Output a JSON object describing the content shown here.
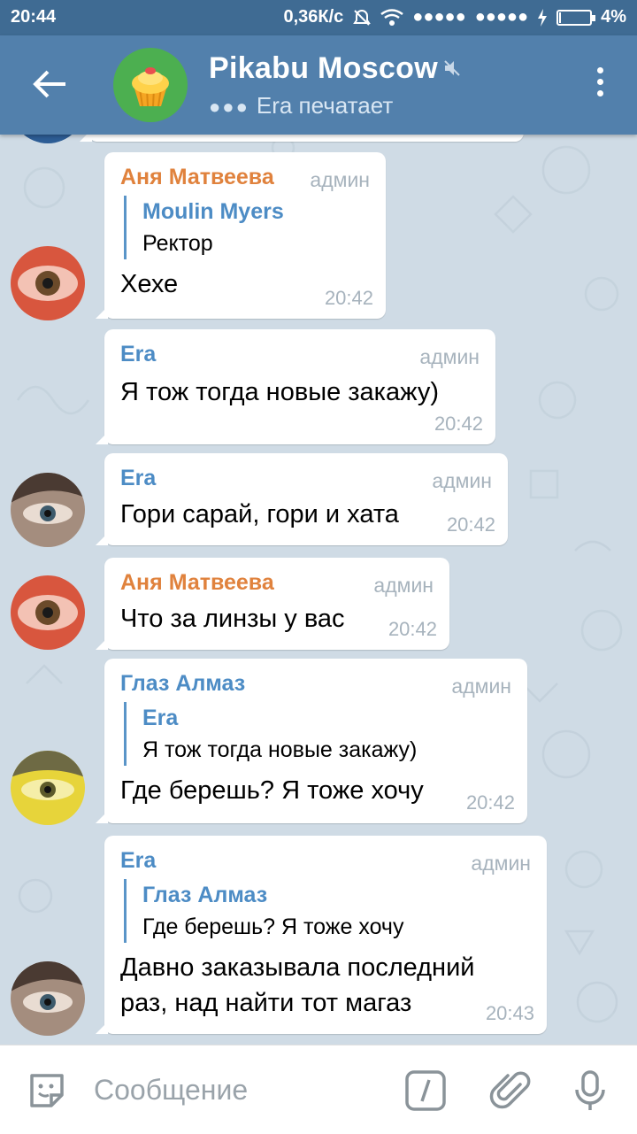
{
  "status": {
    "time": "20:44",
    "speed": "0,36К/с",
    "battery": "4%"
  },
  "header": {
    "title": "Pikabu Moscow",
    "typing": "Era печатает"
  },
  "messages": [
    {
      "sender": "Аня Матвеева",
      "role": "админ",
      "reply_name": "Moulin Myers",
      "reply_text": "Ректор",
      "text": "Хехе",
      "time": "20:42"
    },
    {
      "sender": "Era",
      "role": "админ",
      "text": "Я тож тогда новые закажу)",
      "time": "20:42"
    },
    {
      "sender": "Era",
      "role": "админ",
      "text": "Гори сарай, гори и хата",
      "time": "20:42"
    },
    {
      "sender": "Аня Матвеева",
      "role": "админ",
      "text": "Что за линзы у вас",
      "time": "20:42"
    },
    {
      "sender": "Глаз Алмаз",
      "role": "админ",
      "reply_name": "Era",
      "reply_text": "Я тож тогда новые закажу)",
      "text": "Где берешь? Я тоже хочу",
      "time": "20:42"
    },
    {
      "sender": "Era",
      "role": "админ",
      "reply_name": "Глаз Алмаз",
      "reply_text": "Где берешь? Я тоже хочу",
      "text_line1": "Давно заказывала последний",
      "text_line2": "раз, над найти тот магаз",
      "time": "20:43"
    }
  ],
  "input": {
    "placeholder": "Сообщение"
  },
  "colors": {
    "header": "#5280ac",
    "statusbar": "#3f6b93",
    "orange_name": "#e0823d",
    "blue_name": "#4d8cc5",
    "admin": "#a7b3bd"
  }
}
